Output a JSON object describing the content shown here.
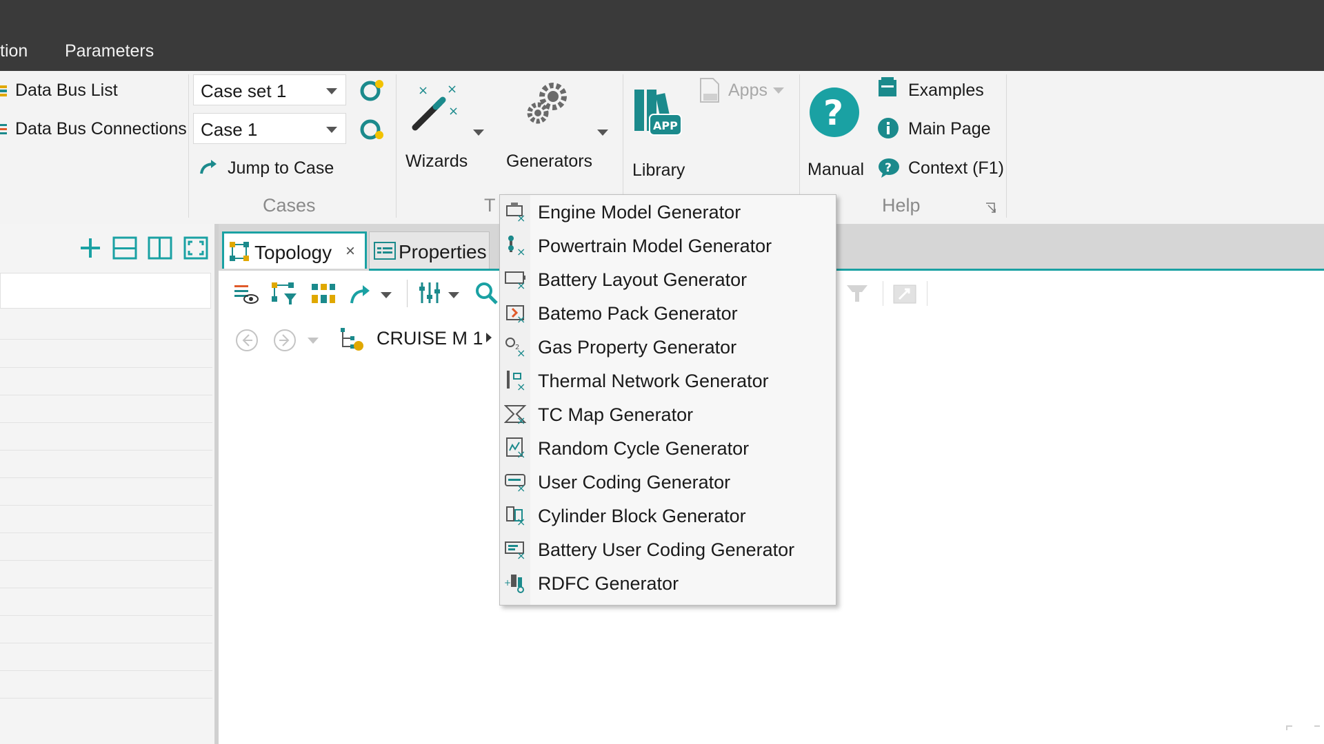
{
  "menubar": {
    "tabs": [
      "tion",
      "Parameters"
    ]
  },
  "ribbon": {
    "data_bus_list": "Data Bus List",
    "data_bus_connections": "Data Bus Connections",
    "case_set": "Case set 1",
    "case": "Case 1",
    "jump_to_case": "Jump to Case",
    "cases_group": "Cases",
    "wizards": "Wizards",
    "generators": "Generators",
    "tools_group_partial": "T",
    "library": "Library",
    "apps": "Apps",
    "manual": "Manual",
    "examples": "Examples",
    "main_page": "Main Page",
    "context": "Context (F1)",
    "help_group": "Help"
  },
  "tabs": {
    "topology": "Topology",
    "topology_close": "×",
    "properties": "Properties"
  },
  "breadcrumb": {
    "model": "CRUISE M 1"
  },
  "generators_menu": {
    "items": [
      "Engine Model Generator",
      "Powertrain Model Generator",
      "Battery Layout Generator",
      "Batemo Pack Generator",
      "Gas Property Generator",
      "Thermal Network Generator",
      "TC Map Generator",
      "Random Cycle Generator",
      "User Coding Generator",
      "Cylinder Block Generator",
      "Battery User Coding Generator",
      "RDFC Generator"
    ]
  },
  "colors": {
    "accent": "#1aa1a3",
    "titlebar": "#3a3a3a",
    "ribbon": "#f3f3f3",
    "icon_teal": "#1b8a8c"
  }
}
